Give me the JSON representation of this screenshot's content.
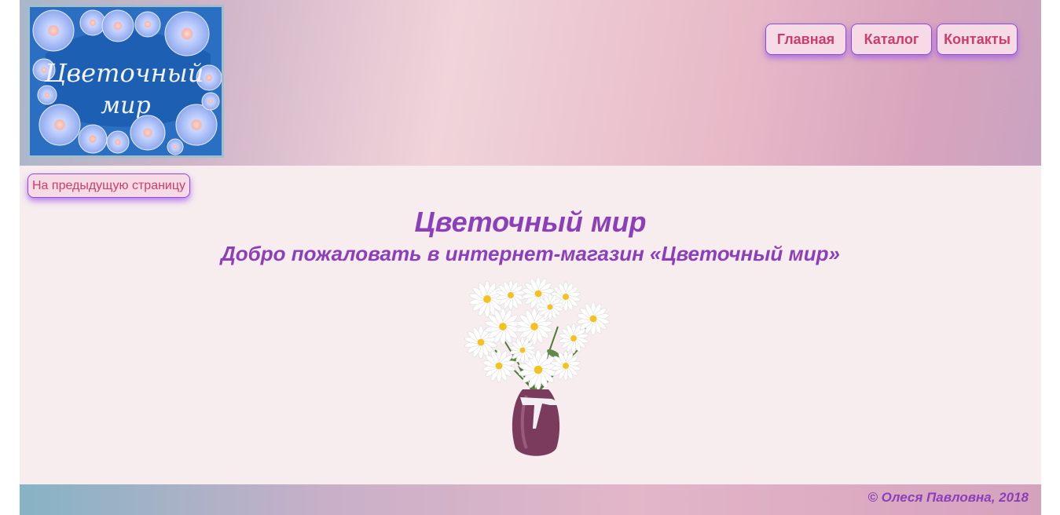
{
  "header": {
    "logo_text_line1": "Цветочный",
    "logo_text_line2": "мир"
  },
  "nav": {
    "items": [
      {
        "label": "Главная"
      },
      {
        "label": "Каталог"
      },
      {
        "label": "Контакты"
      }
    ]
  },
  "back_button": {
    "label": "На предыдущую страницу"
  },
  "main": {
    "title": "Цветочный мир",
    "subtitle": "Добро пожаловать в интернет-магазин «Цветочный мир»"
  },
  "footer": {
    "copyright": "© Олеся Павловна, 2018"
  },
  "colors": {
    "accent": "#8b3fb8",
    "button_text": "#cc3d6a",
    "button_bg": "#f6dbe6",
    "page_bg": "#f7ecee"
  }
}
